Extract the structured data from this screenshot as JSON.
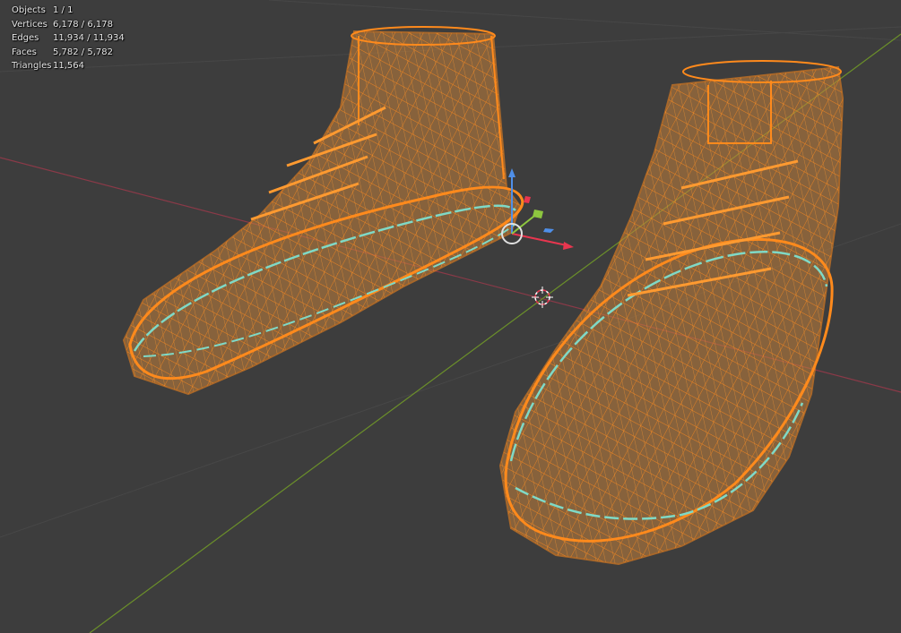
{
  "stats": {
    "objects": {
      "label": "Objects",
      "value": "1 / 1"
    },
    "vertices": {
      "label": "Vertices",
      "value": "6,178 / 6,178"
    },
    "edges": {
      "label": "Edges",
      "value": "11,934 / 11,934"
    },
    "faces": {
      "label": "Faces",
      "value": "5,782 / 5,782"
    },
    "triangles": {
      "label": "Triangles",
      "value": "11,564"
    }
  },
  "colors": {
    "background": "#3d3d3d",
    "grid": "#474747",
    "x_axis": "#8a3a48",
    "y_axis": "#6b8f2a",
    "wire_fill": "#c4813c",
    "wire": "#ff8a1c",
    "seam": "#7fd9c6",
    "gizmo_x": "#e8364f",
    "gizmo_y": "#8dc63f",
    "gizmo_z": "#4f8fe8"
  }
}
